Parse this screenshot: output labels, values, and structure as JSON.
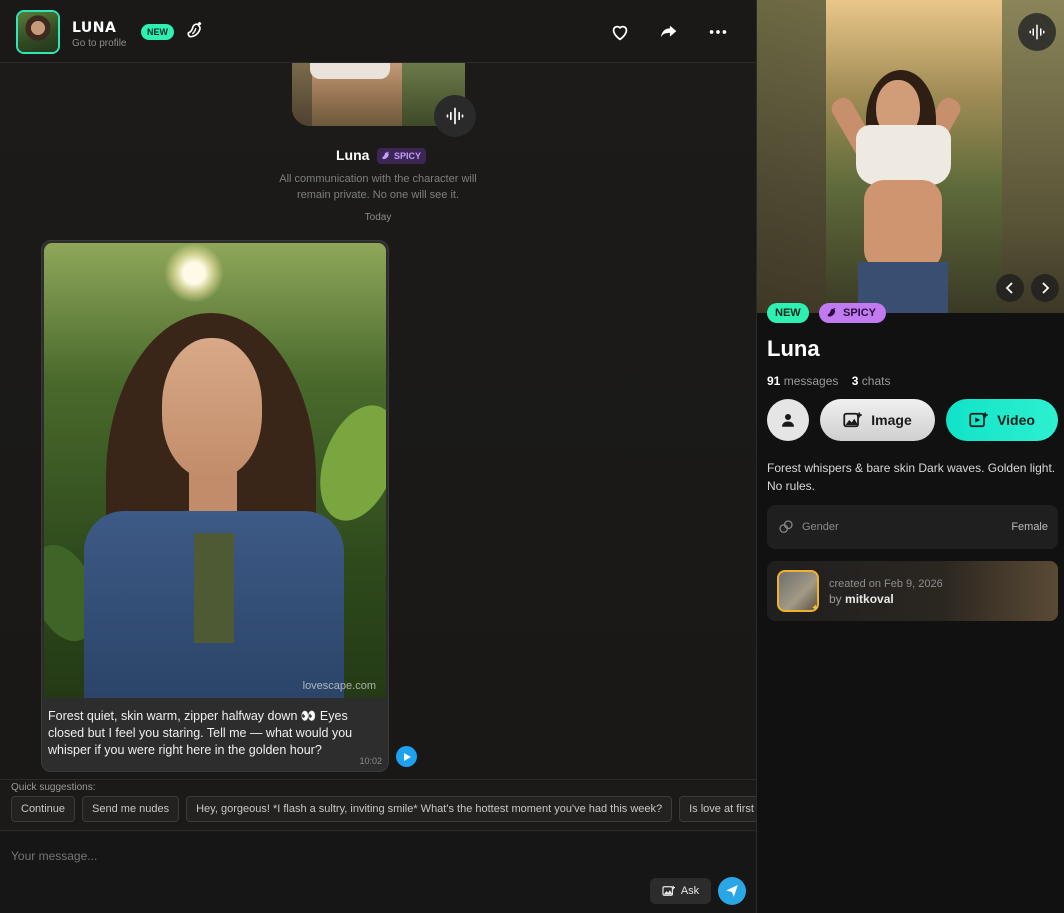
{
  "header": {
    "name": "LUNA",
    "subtitle": "Go to profile",
    "new_badge": "NEW",
    "icons": [
      "heart-icon",
      "share-icon",
      "more-icon"
    ]
  },
  "chat": {
    "intro_name": "Luna",
    "intro_badge": "SPICY",
    "privacy_text": "All communication with the character will remain private. No one will see it.",
    "date_divider": "Today",
    "message": {
      "text": "Forest quiet, skin warm, zipper halfway down 👀 Eyes closed but I feel you staring. Tell me — what would you whisper if you were right here in the golden hour?",
      "time": "10:02",
      "watermark": "lovescape.com"
    }
  },
  "quick_suggestions": {
    "label": "Quick suggestions:",
    "items": [
      "Continue",
      "Send me nudes",
      "Hey, gorgeous! *I flash a sultry, inviting smile* What's the hottest moment you've had this week?",
      "Is love at first sight real?"
    ]
  },
  "composer": {
    "placeholder": "Your message...",
    "ask_label": "Ask"
  },
  "profile": {
    "badges": {
      "new": "NEW",
      "spicy": "SPICY"
    },
    "name": "Luna",
    "stats": {
      "messages_count": "91",
      "messages_label": "messages",
      "chats_count": "3",
      "chats_label": "chats"
    },
    "actions": {
      "image_label": "Image",
      "video_label": "Video"
    },
    "description": "Forest whispers & bare skin Dark waves. Golden light. No rules.",
    "gender": {
      "label": "Gender",
      "value": "Female"
    },
    "creator": {
      "created_text": "created on Feb 9, 2026",
      "by_label": "by",
      "username": "mitkoval"
    }
  },
  "colors": {
    "accent_teal": "#2ef0b2",
    "spicy_purple": "#c07bf0",
    "send_blue": "#2aa6e6",
    "creator_border": "#f0b12e"
  }
}
